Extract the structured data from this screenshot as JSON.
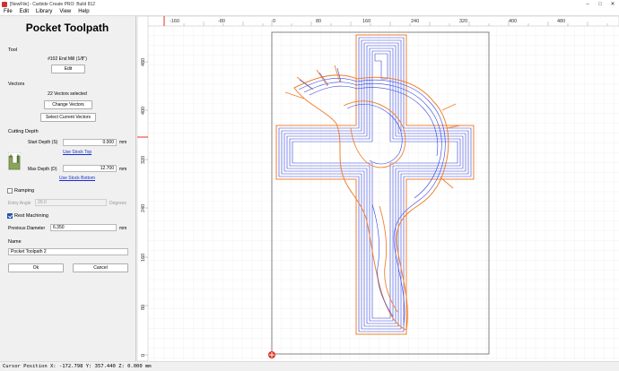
{
  "window": {
    "title": "[NewFile] - Carbide Create PRO: Build 812",
    "minimize_icon": "minimize-icon",
    "maximize_icon": "maximize-icon",
    "close_icon": "close-icon"
  },
  "menu": {
    "items": [
      "File",
      "Edit",
      "Library",
      "View",
      "Help"
    ]
  },
  "panel": {
    "title": "Pocket Toolpath",
    "tool": {
      "label": "Tool",
      "name": "#102 End Mill (1/8\")",
      "edit_button": "Edit"
    },
    "vectors": {
      "label": "Vectors",
      "selected": "22 Vectors selected",
      "change_button": "Change Vectors",
      "select_button": "Select Current Vectors"
    },
    "cutting_depth": {
      "label": "Cutting Depth",
      "start_label": "Start Depth (S)",
      "start_value": "0.000",
      "start_unit": "mm",
      "use_stock_top": "Use Stock Top",
      "max_label": "Max Depth (D)",
      "max_value": "12.700",
      "max_unit": "mm",
      "use_stock_bottom": "Use Stock Bottom"
    },
    "ramping": {
      "label": "Ramping",
      "checked": false,
      "entry_angle_label": "Entry Angle",
      "entry_angle_value": "20.0",
      "entry_angle_unit": "Degrees"
    },
    "rest_machining": {
      "label": "Rest Machining",
      "checked": true,
      "prev_diameter_label": "Previous Diameter",
      "prev_diameter_value": "6.350",
      "prev_diameter_unit": "mm"
    },
    "name": {
      "label": "Name",
      "value": "Pocket Toolpath 2"
    },
    "ok_button": "Ok",
    "cancel_button": "Cancel"
  },
  "rulers": {
    "horizontal": [
      "-160",
      "-80",
      "0",
      "80",
      "160",
      "240",
      "320",
      "400",
      "480"
    ],
    "vertical": [
      "480",
      "400",
      "320",
      "240",
      "160",
      "80",
      "0"
    ]
  },
  "status": {
    "cursor": "Cursor Position X: -172.798 Y: 357.440 Z: 0.000 mm"
  },
  "colors": {
    "accent_red": "#e03020",
    "toolpath_blue": "#3344dd",
    "vector_orange": "#f08030",
    "grid": "#e4e4e4"
  },
  "icons": {
    "depth_diagram": "cut-depth-diagram-icon",
    "origin": "origin-icon"
  }
}
